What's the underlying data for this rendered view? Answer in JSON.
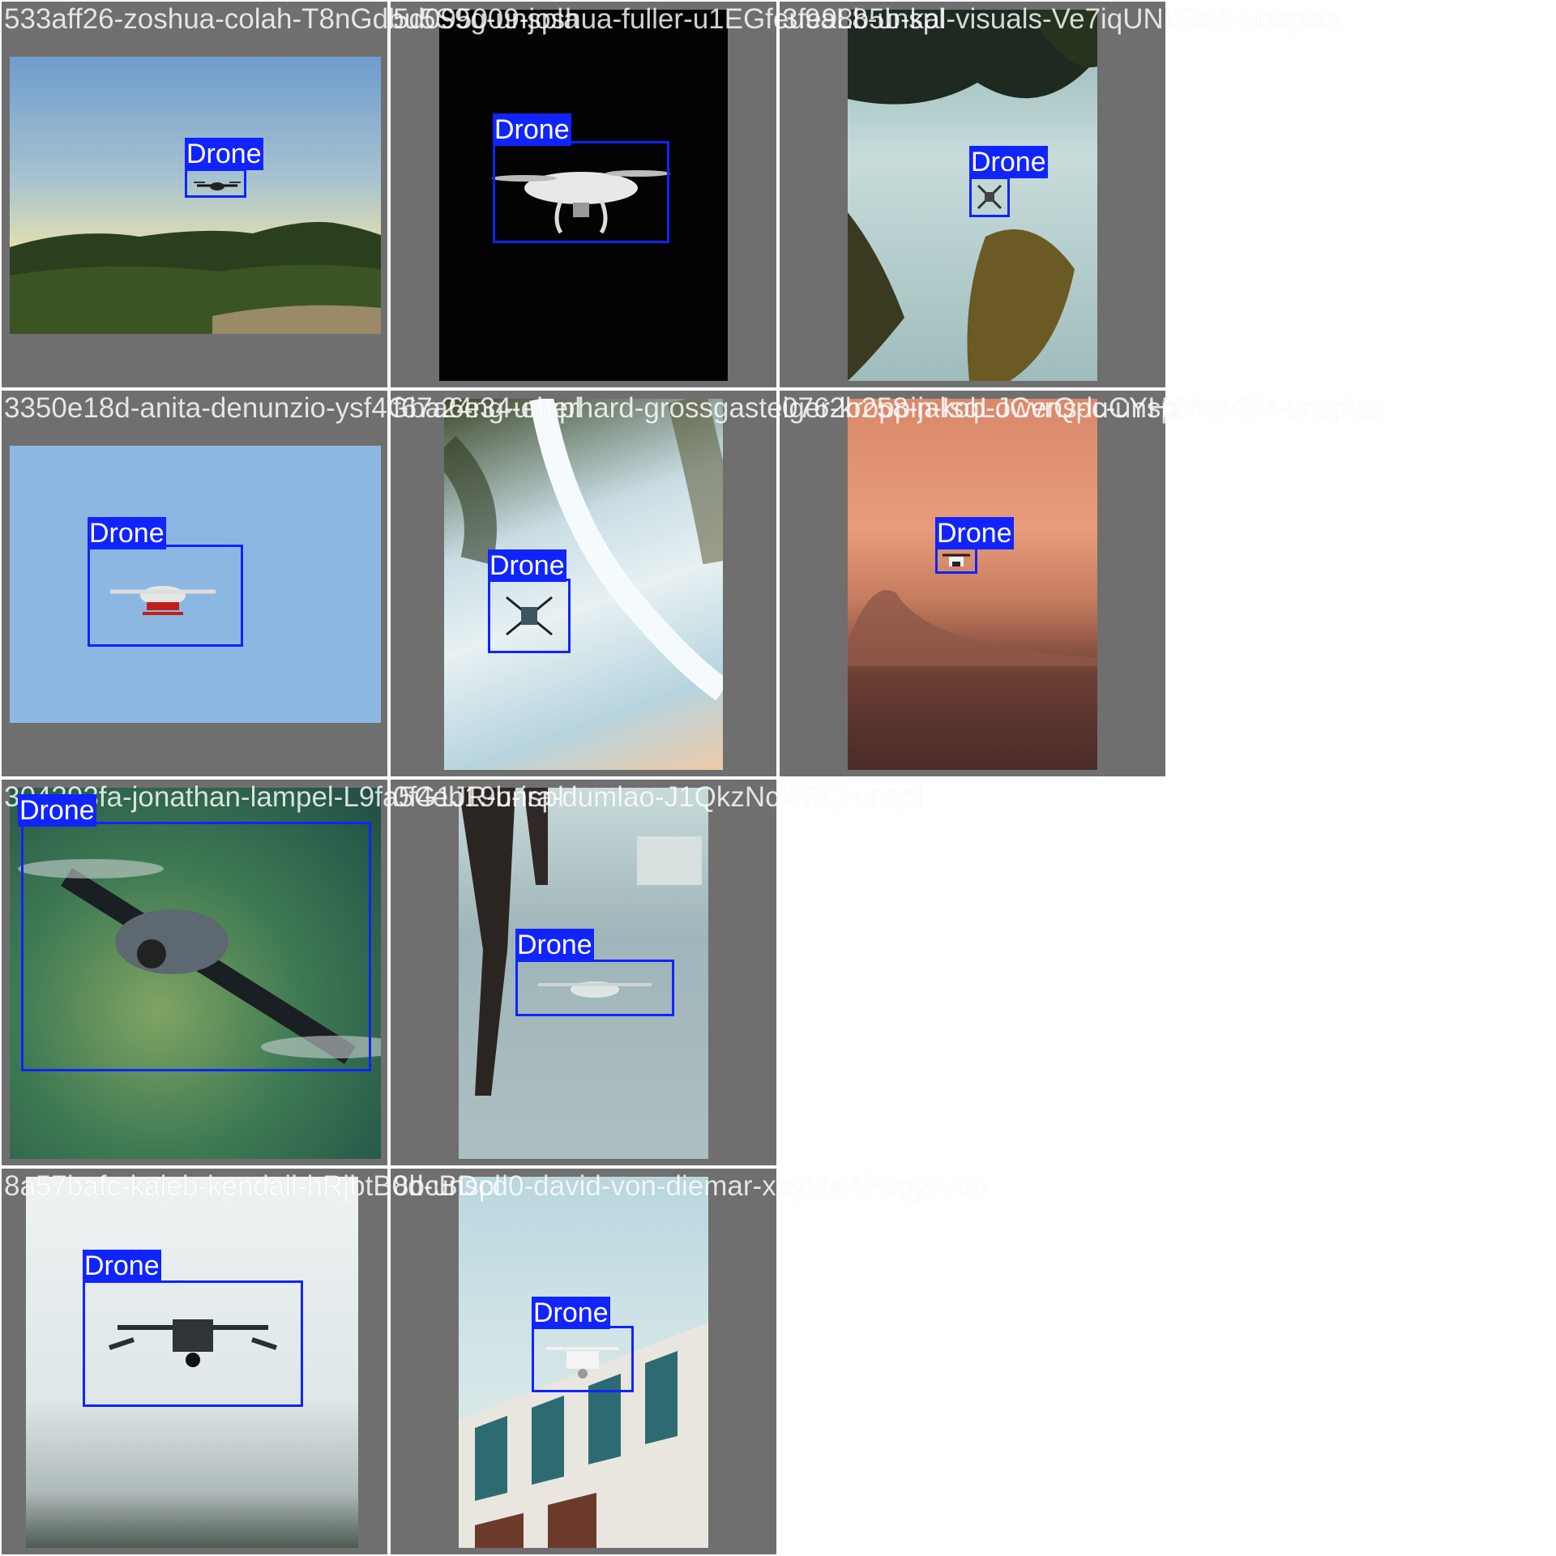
{
  "colors": {
    "tile_bg": "#6f6f6f",
    "box": "#1024ff",
    "label_text": "#ffffff"
  },
  "tiles": [
    {
      "filename": "533aff26-zoshua-colah-T8nGdbu5S9g-unspla",
      "label": "Drone"
    },
    {
      "filename": "5d095009-joshua-fuller-u1EGfeu9aL8-unspl",
      "label": "Drone"
    },
    {
      "filename": "3fe98b5b-kal-visuals-Ve7iqUNkGsA-unsplas",
      "label": "Drone"
    },
    {
      "filename": "3350e18d-anita-denunzio-ysf4Gba24ng-unspl",
      "label": "Drone"
    },
    {
      "filename": "f67a6e34-eberhard-grossgasteiger-kroppin-IsqLJCvrQpc-unspl",
      "label": "Drone"
    },
    {
      "filename": "0762b258-jakob-owens-luCYHzWsv2M-unsplas",
      "label": "Drone"
    },
    {
      "filename": "304393fa-jonathan-lampel-L9fa5G1JR-unspl",
      "label": "Drone"
    },
    {
      "filename": "0f4eb19b-ira-dumlao-J1QkzNckrRQ-unspl",
      "label": "Drone"
    },
    {
      "filename": "8a57bafc-kaleb-kendall-hRjbtB0d-unspl",
      "label": "Drone"
    },
    {
      "filename": "8bcBDcd0-david-von-diemar-xoyHw4P0gyA-un",
      "label": "Drone"
    }
  ]
}
